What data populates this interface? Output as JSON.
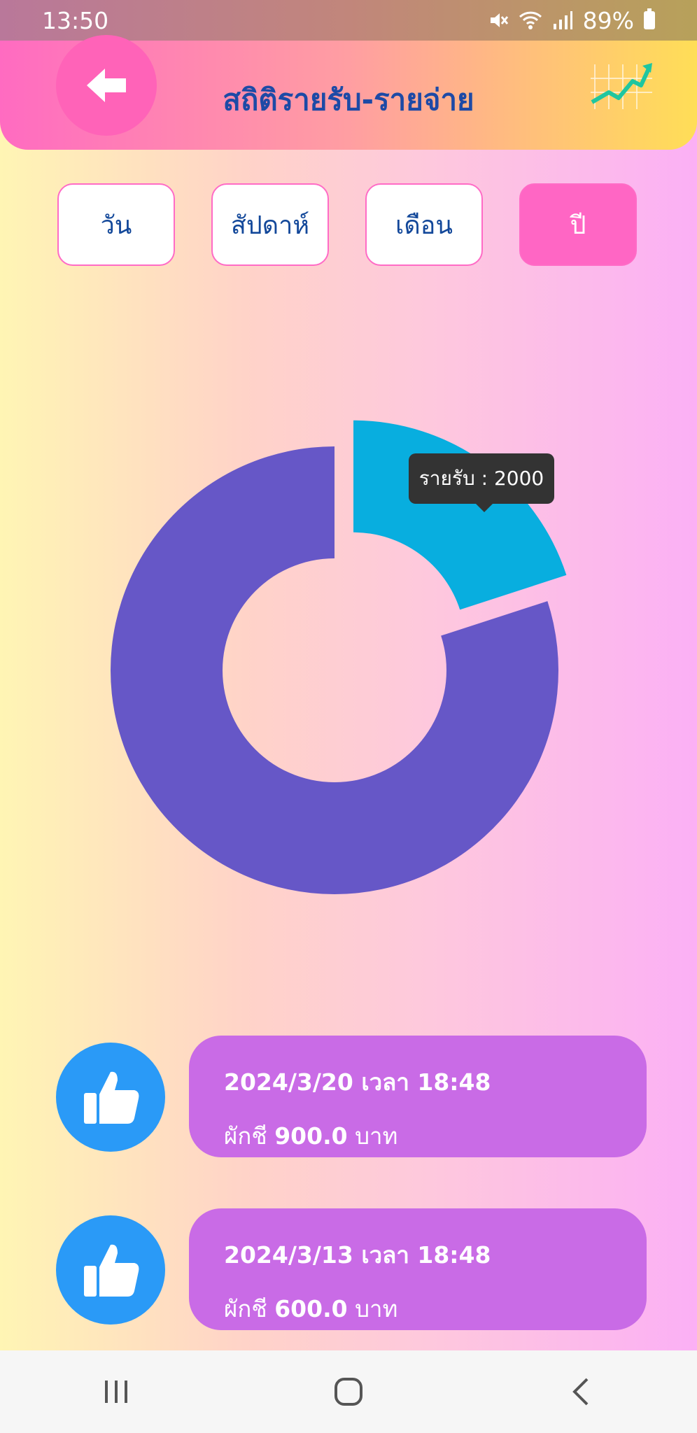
{
  "status_bar": {
    "time": "13:50",
    "battery": "89%"
  },
  "header": {
    "title": "สถิติรายรับ-รายจ่าย"
  },
  "tabs": [
    {
      "label": "วัน"
    },
    {
      "label": "สัปดาห์"
    },
    {
      "label": "เดือน"
    },
    {
      "label": "ปี"
    }
  ],
  "active_tab": "ปี",
  "chart": {
    "tooltip": "รายรับ : 2000"
  },
  "chart_data": {
    "type": "pie",
    "series": [
      {
        "name": "รายรับ",
        "value": 2000,
        "color": "#08aedf"
      },
      {
        "value": 8000,
        "color": "#6657c7"
      }
    ]
  },
  "records": [
    {
      "date_line": "2024/3/20 เวลา 18:48",
      "item": "ผักชี",
      "amount": "900.0",
      "unit": "บาท"
    },
    {
      "date_line": "2024/3/13 เวลา 18:48",
      "item": "ผักชี",
      "amount": "600.0",
      "unit": "บาท"
    }
  ],
  "colors": {
    "accent_pink": "#ff66c4",
    "title_blue": "#1d4aa6",
    "card_purple": "#c96be6",
    "like_blue": "#2a9af7"
  }
}
